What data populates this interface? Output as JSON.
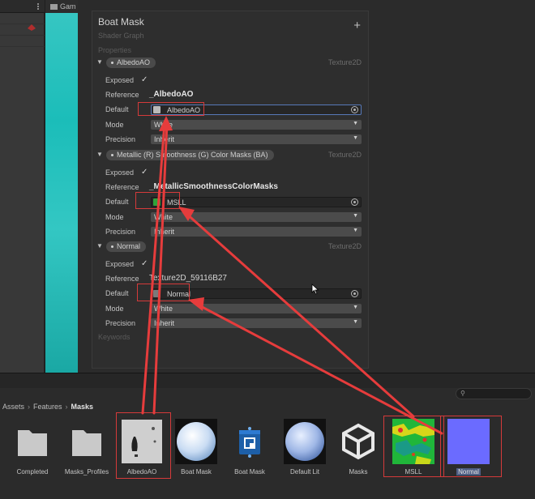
{
  "editor": {
    "game_tab": "Gam"
  },
  "blackboard": {
    "title": "Boat Mask",
    "subtitle": "Shader Graph",
    "add_label": "+",
    "properties_header": "Properties",
    "keywords_header": "Keywords",
    "row_labels": {
      "exposed": "Exposed",
      "reference": "Reference",
      "default": "Default",
      "mode": "Mode",
      "precision": "Precision"
    },
    "check_mark": "✓",
    "properties": [
      {
        "name": "AlbedoAO",
        "type": "Texture2D",
        "reference": "_AlbedoAO",
        "default": "AlbedoAO",
        "mode": "White",
        "precision": "Inherit",
        "thumb_color": "#b9b9b9"
      },
      {
        "name": "Metallic (R) Smoothness (G) Color Masks (BA)",
        "type": "Texture2D",
        "reference": "_MetallicSmoothnessColorMasks",
        "default": "MSLL",
        "mode": "White",
        "precision": "Inherit",
        "thumb_color": "#2fa33a"
      },
      {
        "name": "Normal",
        "type": "Texture2D",
        "reference": "Texture2D_59116B27",
        "default": "Normal",
        "mode": "White",
        "precision": "Inherit",
        "thumb_color": "#7a7a7a"
      }
    ]
  },
  "project": {
    "breadcrumb": [
      "Assets",
      "Features",
      "Masks"
    ],
    "assets": [
      {
        "name": "Completed",
        "kind": "folder-icon"
      },
      {
        "name": "Masks_Profiles",
        "kind": "folder-icon"
      },
      {
        "name": "AlbedoAO",
        "kind": "texture-albedo"
      },
      {
        "name": "Boat Mask",
        "kind": "material-sphere"
      },
      {
        "name": "Boat Mask",
        "kind": "shader-graph-icon"
      },
      {
        "name": "Default Lit",
        "kind": "material-sphere-lit"
      },
      {
        "name": "Masks",
        "kind": "unity-logo-icon"
      },
      {
        "name": "MSLL",
        "kind": "texture-msll"
      },
      {
        "name": "Normal",
        "kind": "texture-normal"
      }
    ]
  },
  "colors": {
    "highlight": "#d53a3a",
    "normal_map": "#6b6bff",
    "selection": "#4f5f85"
  }
}
